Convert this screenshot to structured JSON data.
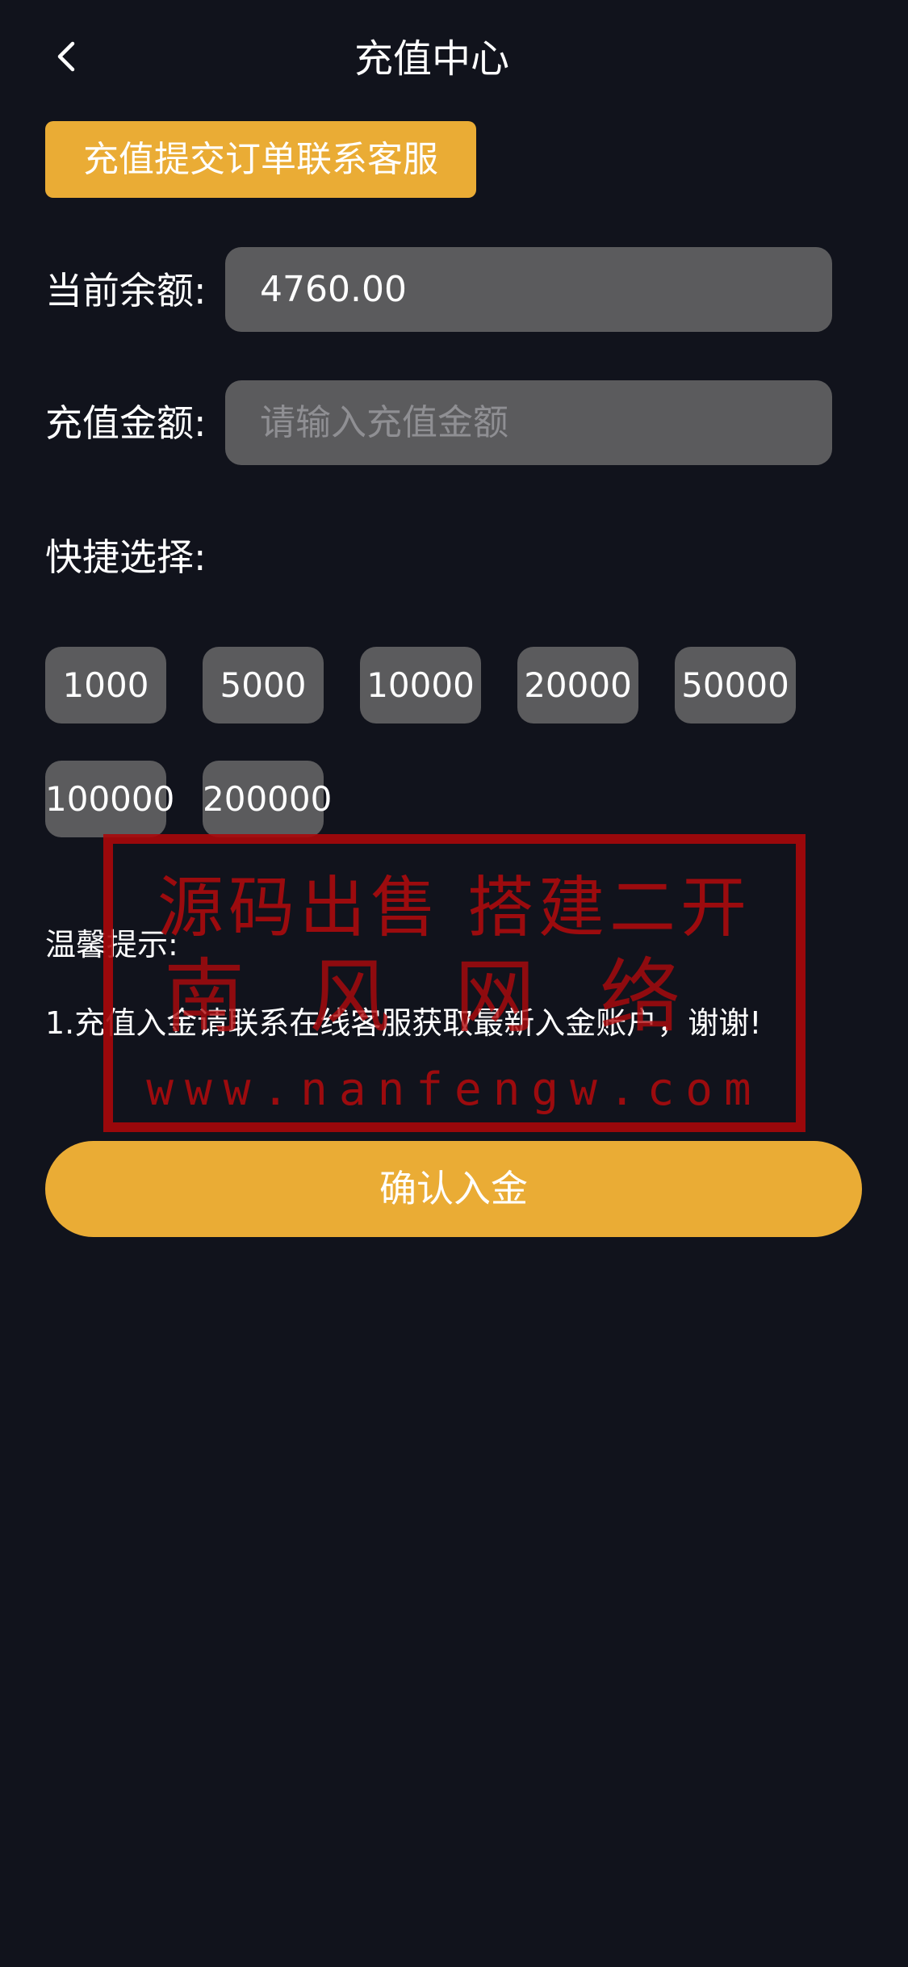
{
  "header": {
    "title": "充值中心",
    "back_icon": "chevron-left-icon"
  },
  "contact_button": {
    "label": "充值提交订单联系客服"
  },
  "balance": {
    "label": "当前余额:",
    "value": "4760.00"
  },
  "amount": {
    "label": "充值金额:",
    "placeholder": "请输入充值金额",
    "value": ""
  },
  "quick_select": {
    "label": "快捷选择:",
    "options": [
      "1000",
      "5000",
      "10000",
      "20000",
      "50000",
      "100000",
      "200000"
    ]
  },
  "tips": {
    "title": "温馨提示:",
    "text": "1.充值入金请联系在线客服获取最新入金账户，谢谢!"
  },
  "confirm_button": {
    "label": "确认入金"
  },
  "watermark": {
    "line1": "源码出售 搭建二开",
    "line2": "南风网络",
    "line3": "www.nanfengw.com"
  },
  "colors": {
    "background": "#11131c",
    "accent": "#eaac35",
    "field": "#5b5b5d",
    "watermark": "#aa080a"
  }
}
